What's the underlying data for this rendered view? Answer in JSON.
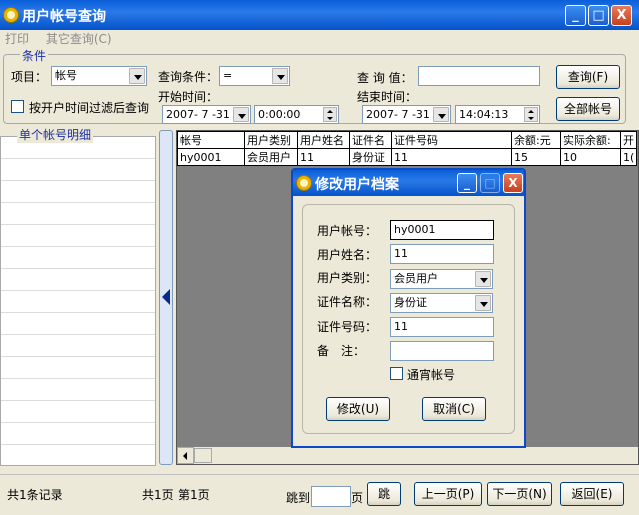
{
  "window": {
    "title": "用户帐号查询",
    "minimize": "_",
    "maximize": "□",
    "close": "X"
  },
  "menu": {
    "items": [
      "打印",
      "其它查询(C)"
    ]
  },
  "conditions": {
    "group_label": "条件",
    "item_label": "项目：",
    "item_value": "帐号",
    "query_condition_label": "查询条件：",
    "query_condition_value": "=",
    "query_value_label": "查 询 值：",
    "query_value": "",
    "query_button": "查询(F)",
    "filter_checkbox_label": "按开户时间过滤后查询",
    "filter_checked": false,
    "start_time_label": "开始时间：",
    "start_date": "2007- 7 -31",
    "start_time": "0:00:00",
    "end_time_label": "结束时间：",
    "end_date": "2007- 7 -31",
    "end_time": "14:04:13",
    "all_accounts_button": "全部帐号"
  },
  "left_panel": {
    "label": "单个帐号明细"
  },
  "grid": {
    "columns": [
      "帐号",
      "用户类别",
      "用户姓名",
      "证件名",
      "证件号码",
      "余额:元",
      "实际余额:",
      "开"
    ],
    "rows": [
      [
        "hy0001",
        "会员用户",
        "11",
        "身份证",
        "11",
        "15",
        "10",
        "1("
      ]
    ]
  },
  "status": {
    "record_count": "共1条记录",
    "total_pages": "共1页",
    "current_page": "第1页",
    "goto_label": "跳到",
    "goto_value": "",
    "page_suffix": "页",
    "goto_button": "跳",
    "prev_button": "上一页(P)",
    "next_button": "下一页(N)",
    "back_button": "返回(E)"
  },
  "dialog": {
    "title": "修改用户档案",
    "account_label": "用户帐号：",
    "account_value": "hy0001",
    "name_label": "用户姓名：",
    "name_value": "11",
    "category_label": "用户类别：",
    "category_value": "会员用户",
    "id_name_label": "证件名称：",
    "id_name_value": "身份证",
    "id_number_label": "证件号码：",
    "id_number_value": "11",
    "remark_label": "备　注：",
    "remark_value": "",
    "tongyu_label": "通宵帐号",
    "tongyu_checked": false,
    "modify_button": "修改(U)",
    "cancel_button": "取消(C)"
  }
}
